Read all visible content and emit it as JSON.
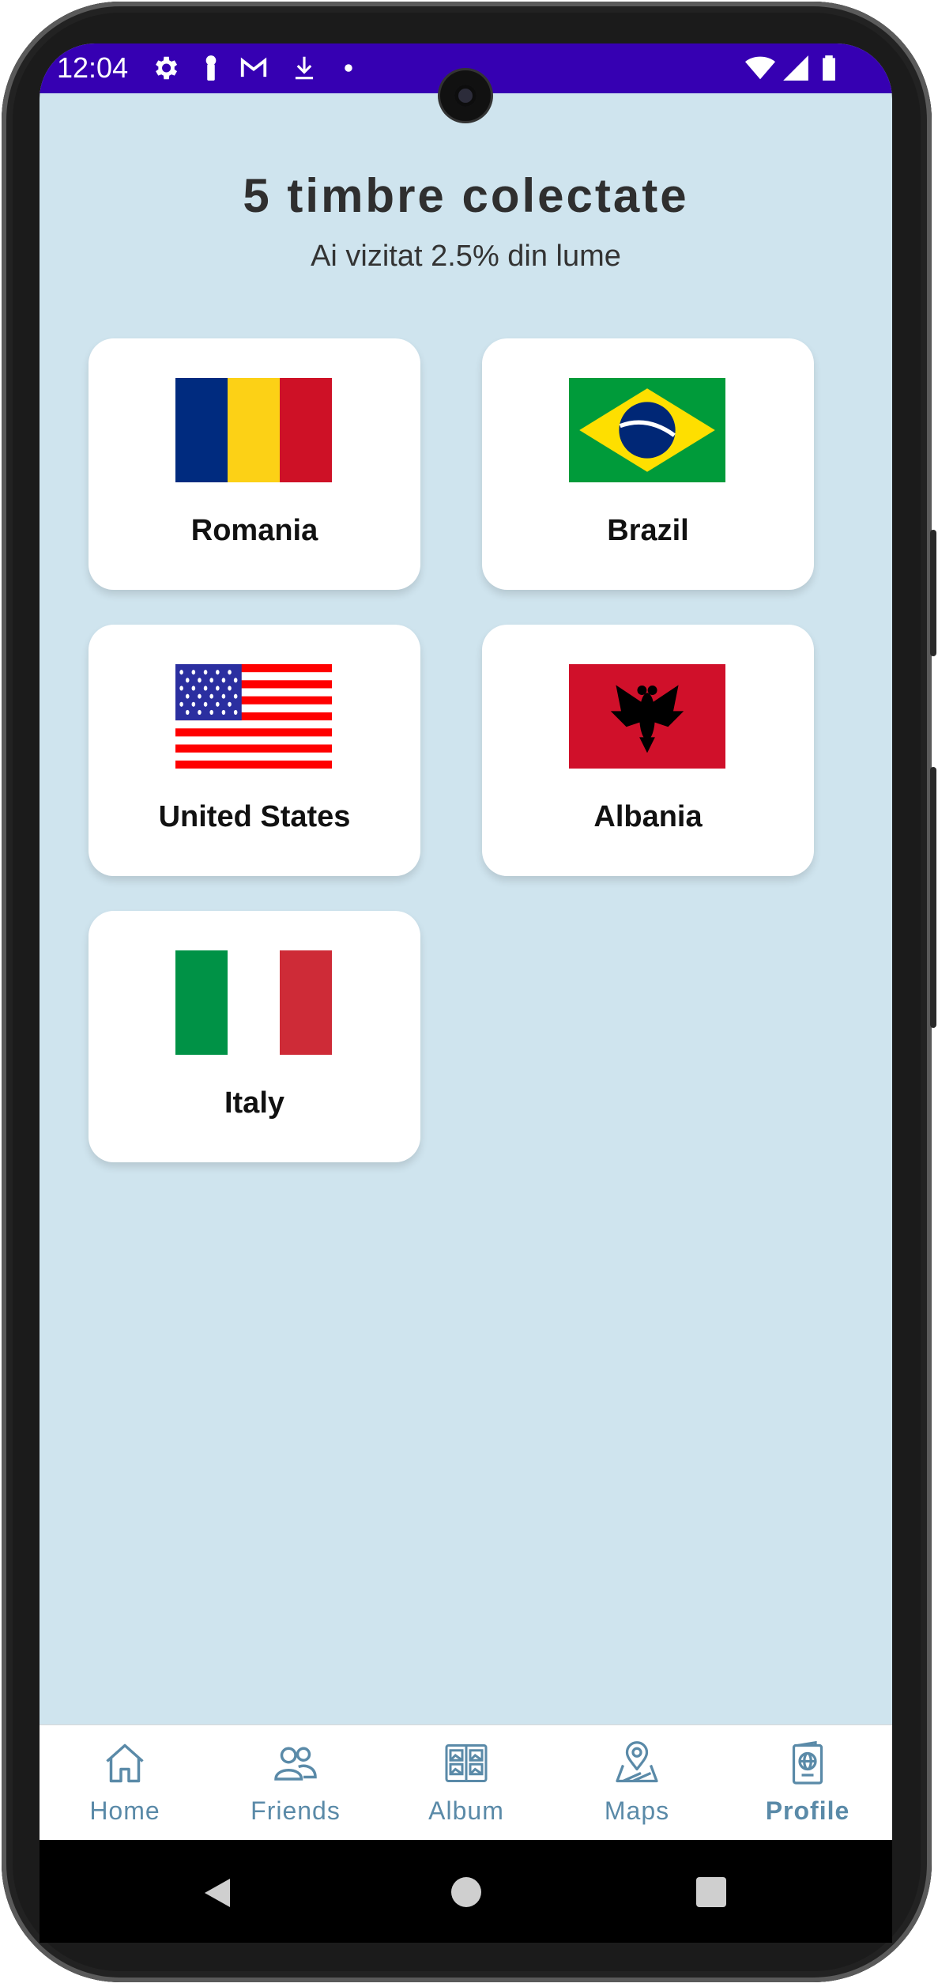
{
  "status": {
    "time": "12:04",
    "bar_color": "#3600b2",
    "left_icons": [
      "settings-icon",
      "key-icon",
      "gmail-icon",
      "download-icon",
      "dot-icon"
    ],
    "right_icons": [
      "wifi-icon",
      "signal-icon",
      "battery-icon"
    ]
  },
  "header": {
    "title": "5 timbre colectate",
    "subtitle": "Ai vizitat 2.5% din lume"
  },
  "stamps": [
    {
      "country": "Romania",
      "flag": "romania-flag"
    },
    {
      "country": "Brazil",
      "flag": "brazil-flag"
    },
    {
      "country": "United States",
      "flag": "usa-flag"
    },
    {
      "country": "Albania",
      "flag": "albania-flag"
    },
    {
      "country": "Italy",
      "flag": "italy-flag"
    }
  ],
  "nav": {
    "items": [
      {
        "label": "Home",
        "icon": "home-icon",
        "active": false
      },
      {
        "label": "Friends",
        "icon": "friends-icon",
        "active": false
      },
      {
        "label": "Album",
        "icon": "album-icon",
        "active": false
      },
      {
        "label": "Maps",
        "icon": "map-pin-icon",
        "active": false
      },
      {
        "label": "Profile",
        "icon": "passport-icon",
        "active": true
      }
    ],
    "accent": "#5a8aa8"
  },
  "system_nav": [
    "back-icon",
    "home-circle-icon",
    "recents-icon"
  ],
  "colors": {
    "background": "#cfe4ee",
    "card": "#ffffff"
  }
}
